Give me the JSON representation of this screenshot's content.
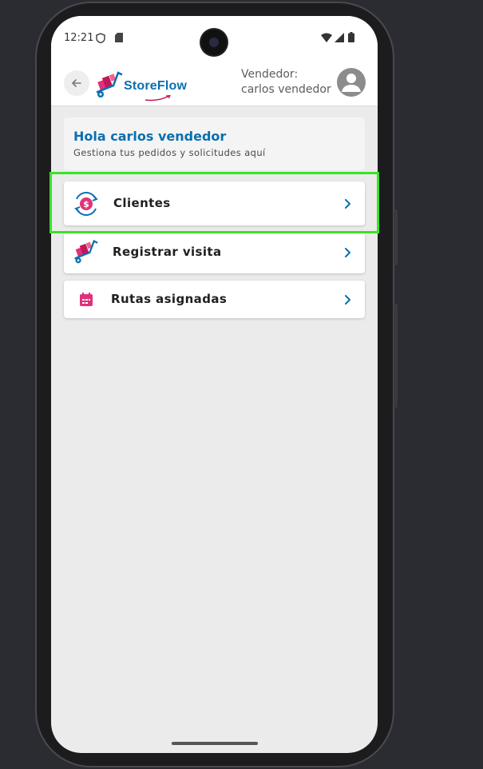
{
  "status_bar": {
    "time": "12:21"
  },
  "header": {
    "brand": "StoreFlow",
    "vendor_line1": "Vendedor:",
    "vendor_line2": "carlos vendedor"
  },
  "greeting": {
    "title": "Hola carlos vendedor",
    "subtitle": "Gestiona tus pedidos y solicitudes aquí"
  },
  "menu": [
    {
      "label": "Clientes",
      "icon": "money-cycle-icon"
    },
    {
      "label": "Registrar visita",
      "icon": "hand-truck-icon"
    },
    {
      "label": "Rutas asignadas",
      "icon": "calendar-icon"
    }
  ],
  "colors": {
    "brand_blue": "#0a6fb1",
    "accent_pink": "#e0317a",
    "highlight_green": "#39e326"
  }
}
